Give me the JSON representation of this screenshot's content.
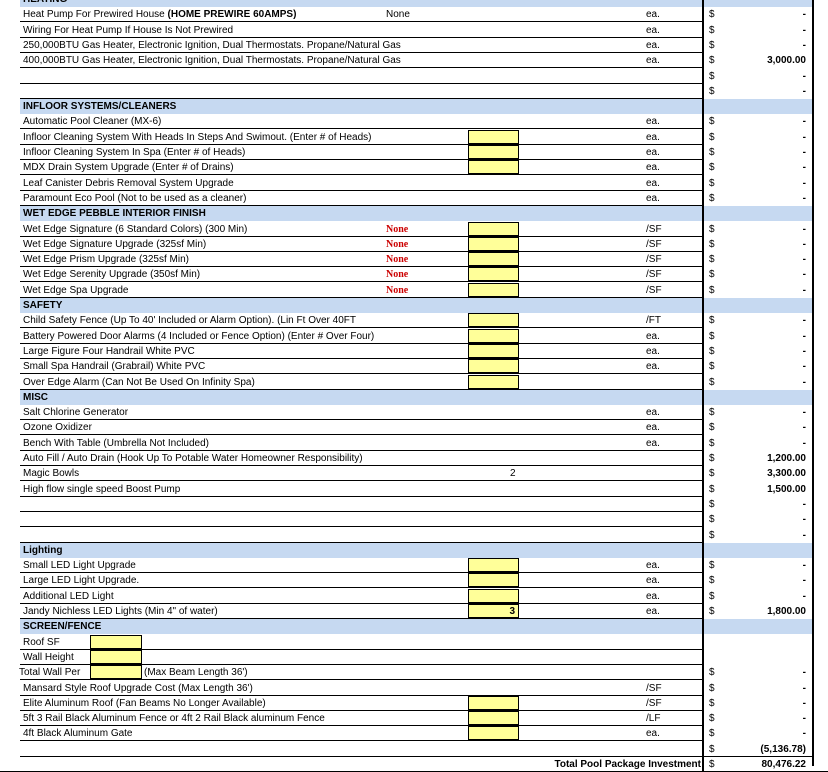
{
  "rows": [
    {
      "type": "section",
      "label": "HEATING"
    },
    {
      "label": "Heat Pump For Prewired House",
      "bold": "(HOME PREWIRE 60AMPS)",
      "note": "None",
      "unit": "ea.",
      "dollar": "$",
      "amt": "-"
    },
    {
      "label": "Wiring For Heat Pump If House Is Not Prewired",
      "unit": "ea.",
      "dollar": "$",
      "amt": "-"
    },
    {
      "label": "250,000BTU Gas Heater, Electronic Ignition, Dual Thermostats. Propane/Natural Gas",
      "unit": "ea.",
      "dollar": "$",
      "amt": "-"
    },
    {
      "label": "400,000BTU Gas Heater, Electronic Ignition, Dual Thermostats. Propane/Natural Gas",
      "unit": "ea.",
      "dollar": "$",
      "amt": "3,000.00"
    },
    {
      "label": "",
      "dollar": "$",
      "amt": "-"
    },
    {
      "label": "",
      "dollar": "$",
      "amt": "-"
    },
    {
      "type": "section",
      "label": "INFLOOR SYSTEMS/CLEANERS"
    },
    {
      "label": "Automatic Pool Cleaner (MX-6)",
      "unit": "ea.",
      "dollar": "$",
      "amt": "-"
    },
    {
      "label": "Infloor Cleaning System With Heads In Steps And Swimout. (Enter # of Heads)",
      "box": true,
      "unit": "ea.",
      "dollar": "$",
      "amt": "-"
    },
    {
      "label": "Infloor Cleaning System In Spa (Enter # of Heads)",
      "box": true,
      "unit": "ea.",
      "dollar": "$",
      "amt": "-"
    },
    {
      "label": "MDX Drain System Upgrade (Enter # of Drains)",
      "box": true,
      "unit": "ea.",
      "dollar": "$",
      "amt": "-"
    },
    {
      "label": "Leaf Canister Debris Removal System Upgrade",
      "unit": "ea.",
      "dollar": "$",
      "amt": "-"
    },
    {
      "label": "Paramount Eco Pool (Not to be used as a cleaner)",
      "unit": "ea.",
      "dollar": "$",
      "amt": "-"
    },
    {
      "type": "section",
      "label": "WET EDGE PEBBLE INTERIOR FINISH"
    },
    {
      "label": "Wet Edge Signature (6 Standard Colors) (300 Min)",
      "red": "None",
      "box": true,
      "unit": "/SF",
      "dollar": "$",
      "amt": "-"
    },
    {
      "label": "Wet Edge Signature Upgrade (325sf Min)",
      "red": "None",
      "box": true,
      "unit": "/SF",
      "dollar": "$",
      "amt": "-"
    },
    {
      "label": "Wet Edge Prism Upgrade (325sf Min)",
      "red": "None",
      "box": true,
      "unit": "/SF",
      "dollar": "$",
      "amt": "-"
    },
    {
      "label": "Wet Edge Serenity Upgrade (350sf Min)",
      "red": "None",
      "box": true,
      "unit": "/SF",
      "dollar": "$",
      "amt": "-"
    },
    {
      "label": "Wet Edge Spa Upgrade",
      "red": "None",
      "box": true,
      "unit": "/SF",
      "dollar": "$",
      "amt": "-"
    },
    {
      "type": "section",
      "label": "SAFETY"
    },
    {
      "label": "Child Safety Fence (Up To 40' Included or Alarm Option). (Lin Ft Over 40FT",
      "box": true,
      "unit": "/FT",
      "dollar": "$",
      "amt": "-"
    },
    {
      "label": "Battery Powered Door Alarms (4 Included or Fence Option) (Enter # Over Four)",
      "box": true,
      "unit": "ea.",
      "dollar": "$",
      "amt": "-"
    },
    {
      "label": "Large Figure Four Handrail White PVC",
      "box": true,
      "unit": "ea.",
      "dollar": "$",
      "amt": "-"
    },
    {
      "label": "Small Spa Handrail (Grabrail) White PVC",
      "box": true,
      "unit": "ea.",
      "dollar": "$",
      "amt": "-"
    },
    {
      "label": "Over Edge Alarm (Can Not Be Used On Infinity Spa)",
      "box": true,
      "dollar": "$",
      "amt": "-"
    },
    {
      "type": "section",
      "label": "MISC"
    },
    {
      "label": "Salt Chlorine Generator",
      "unit": "ea.",
      "dollar": "$",
      "amt": "-"
    },
    {
      "label": "Ozone Oxidizer",
      "unit": "ea.",
      "dollar": "$",
      "amt": "-"
    },
    {
      "label": "Bench With Table (Umbrella Not Included)",
      "unit": "ea.",
      "dollar": "$",
      "amt": "-"
    },
    {
      "label": "Auto Fill / Auto Drain (Hook Up To Potable Water Homeowner Responsibility)",
      "dollar": "$",
      "amt": "1,200.00"
    },
    {
      "label": "Magic Bowls",
      "qty": "2",
      "dollar": "$",
      "amt": "3,300.00"
    },
    {
      "label": "High flow single speed Boost Pump",
      "dollar": "$",
      "amt": "1,500.00"
    },
    {
      "label": "",
      "dollar": "$",
      "amt": "-"
    },
    {
      "label": "",
      "dollar": "$",
      "amt": "-"
    },
    {
      "label": "",
      "dollar": "$",
      "amt": "-"
    },
    {
      "type": "section",
      "label": "Lighting"
    },
    {
      "label": "Small  LED Light Upgrade",
      "box": true,
      "unit": "ea.",
      "dollar": "$",
      "amt": "-"
    },
    {
      "label": "Large LED Light Upgrade.",
      "box": true,
      "unit": "ea.",
      "dollar": "$",
      "amt": "-"
    },
    {
      "label": "Additional LED Light",
      "box": true,
      "unit": "ea.",
      "dollar": "$",
      "amt": "-"
    },
    {
      "label": "Jandy Nichless LED Lights (Min 4\" of water)",
      "box": true,
      "boxval": "3",
      "unit": "ea.",
      "dollar": "$",
      "amt": "1,800.00"
    },
    {
      "type": "section",
      "label": "SCREEN/FENCE"
    },
    {
      "label": "Roof SF",
      "smallbox": true
    },
    {
      "label": "Wall Height",
      "smallbox": true
    },
    {
      "label": "Total Wall Per",
      "smallbox": true,
      "after": "(Max Beam Length 36')",
      "shift": true,
      "dollar": "$",
      "amt": "-"
    },
    {
      "label": "Mansard Style Roof Upgrade Cost (Max Length 36')",
      "unit": "/SF",
      "dollar": "$",
      "amt": "-"
    },
    {
      "label": "Elite Aluminum Roof (Fan Beams No Longer Available)",
      "box": true,
      "unit": "/SF",
      "dollar": "$",
      "amt": "-"
    },
    {
      "label": "5ft 3 Rail Black Aluminum Fence or 4ft 2 Rail Black aluminum Fence",
      "box": true,
      "unit": "/LF",
      "dollar": "$",
      "amt": "-"
    },
    {
      "label": "4ft Black Aluminum Gate",
      "box": true,
      "unit": "ea.",
      "dollar": "$",
      "amt": "-"
    },
    {
      "label": "",
      "dollar": "$",
      "amt": "(5,136.78)"
    }
  ],
  "total": {
    "label": "Total Pool Package Investment",
    "dollar": "$",
    "amt": "80,476.22"
  }
}
